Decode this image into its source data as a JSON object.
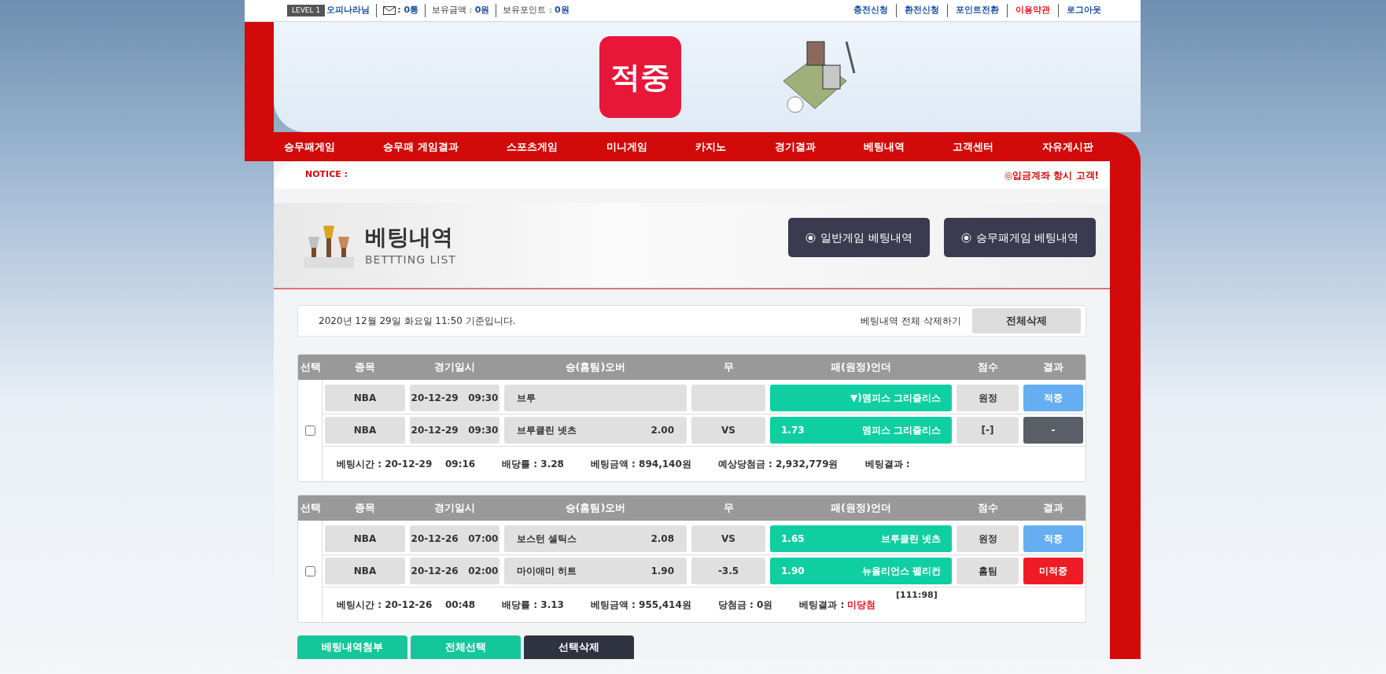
{
  "top_bar": {
    "level_badge": "LEVEL 1",
    "username": "오피나라님",
    "messages": ": 0통",
    "stats": [
      {
        "label": "보유금액 :",
        "value": "0원"
      },
      {
        "label": "보유포인트 :",
        "value": "0원"
      }
    ],
    "links": [
      {
        "label": "충전신청",
        "color": "#1a4fa0"
      },
      {
        "label": "환전신청",
        "color": "#1a4fa0"
      },
      {
        "label": "포인트전환",
        "color": "#1a4fa0"
      },
      {
        "label": "이용약관",
        "color": "#e8161e"
      },
      {
        "label": "로그아웃",
        "color": "#1a4fa0"
      }
    ]
  },
  "logo": {
    "text": "적중"
  },
  "nav": [
    "승무패게임",
    "승무패 게임결과",
    "스포츠게임",
    "미니게임",
    "카지노",
    "경기결과",
    "베팅내역",
    "고객센터",
    "자유게시판"
  ],
  "notice": {
    "label": "NOTICE :",
    "message": "◎입금계좌 항시 고객!"
  },
  "page_title": {
    "title": "베팅내역",
    "subtitle": "BETTTING LIST"
  },
  "tabs": [
    {
      "label": "일반게임 베팅내역"
    },
    {
      "label": "승무패게임 베팅내역"
    }
  ],
  "date_bar": {
    "text": "2020년 12월 29일 화요일 11:50 기준입니다.",
    "delete_all_label": "베팅내역 전체 삭제하기",
    "delete_all_button": "전체삭제"
  },
  "bet_slips": [
    {
      "columns": [
        "선택",
        "종목",
        "경기일시",
        "승(홈팀)오버",
        "무",
        "패(원정)언더",
        "점수",
        "결과"
      ],
      "checked": false,
      "rows": [
        {
          "league": "NBA",
          "date": "20-12-29",
          "time": "09:30",
          "home": {
            "team": "브루"
          },
          "away": {
            "team": "▼)멤피스 그리즐리스"
          },
          "score": "원정",
          "result": {
            "label": "적중",
            "kind": "hit"
          }
        },
        {
          "league": "NBA",
          "date": "20-12-29",
          "time": "09:30",
          "home": {
            "team": "브루클린 넷츠",
            "odds": "2.00"
          },
          "draw": "VS",
          "away": {
            "odds": "1.73",
            "team": "멤피스 그리즐리스"
          },
          "score": "[-]",
          "result": {
            "label": "-",
            "kind": "pending"
          }
        }
      ],
      "summary": [
        {
          "label": "베팅시간 :",
          "value": "20-12-29    09:16"
        },
        {
          "label": "배당률 :",
          "value": "3.28"
        },
        {
          "label": "베팅금액 :",
          "value": "894,140원"
        },
        {
          "label": "예상당첨금 :",
          "value": "2,932,779원"
        },
        {
          "label": "베팅결과 :"
        }
      ]
    },
    {
      "columns": [
        "선택",
        "종목",
        "경기일시",
        "승(홈팀)오버",
        "무",
        "패(원정)언더",
        "점수",
        "결과"
      ],
      "checked": false,
      "rows": [
        {
          "league": "NBA",
          "date": "20-12-26",
          "time": "07:00",
          "home": {
            "team": "보스턴 셀틱스",
            "odds": "2.08"
          },
          "draw": "VS",
          "away": {
            "odds": "1.65",
            "team": "브루클린 넷츠"
          },
          "score": "원정",
          "result": {
            "label": "적중",
            "kind": "hit"
          }
        },
        {
          "league": "NBA",
          "date": "20-12-26",
          "time": "02:00",
          "home": {
            "team": "마이애미 히트",
            "odds": "1.90"
          },
          "draw": "-3.5",
          "away": {
            "odds": "1.90",
            "team": "뉴올리언스 펠리컨"
          },
          "score": "홈팀",
          "result": {
            "label": "미적중",
            "kind": "miss"
          }
        }
      ],
      "summary": [
        {
          "label": "베팅시간 :",
          "value": "20-12-26    00:48"
        },
        {
          "label": "배당률 :",
          "value": "3.13"
        },
        {
          "label": "베팅금액 :",
          "value": "955,414원"
        },
        {
          "label": "당첨금 :",
          "value": "0원"
        },
        {
          "label": "베팅결과 :",
          "value": "미당첨",
          "kind": "loss"
        }
      ],
      "score_note": "[111:98]"
    }
  ],
  "actions": [
    {
      "label": "베팅내역첨부",
      "kind": "primary"
    },
    {
      "label": "전체선택",
      "kind": "primary"
    },
    {
      "label": "선택삭제",
      "kind": "dark"
    }
  ]
}
